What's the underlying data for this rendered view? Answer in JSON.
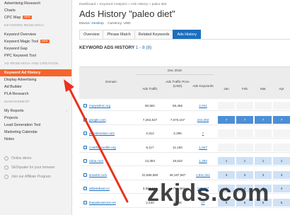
{
  "sidebar": {
    "items": [
      {
        "label": "Advertising Research",
        "type": "item"
      },
      {
        "label": "Charts",
        "type": "item"
      },
      {
        "label": "CPC Map",
        "type": "item",
        "badge": "NEW"
      },
      {
        "label": "KEYWORD RESEARCH",
        "type": "section"
      },
      {
        "label": "Keyword Overview",
        "type": "item"
      },
      {
        "label": "Keyword Magic Tool",
        "type": "item",
        "badge": "NEW"
      },
      {
        "label": "Keyword Gap",
        "type": "item"
      },
      {
        "label": "PPC Keyword Tool",
        "type": "item"
      },
      {
        "label": "AD RESEARCH AND CREATION",
        "type": "section"
      },
      {
        "label": "Keyword Ad History",
        "type": "active"
      },
      {
        "label": "Display Advertising",
        "type": "item"
      },
      {
        "label": "Ad Builder",
        "type": "item"
      },
      {
        "label": "PLA Research",
        "type": "item"
      },
      {
        "label": "MANAGEMENT",
        "type": "section"
      },
      {
        "label": "My Reports",
        "type": "item",
        "chevron": "›"
      },
      {
        "label": "Projects",
        "type": "item"
      },
      {
        "label": "Lead Generation Tool",
        "type": "item"
      },
      {
        "label": "Marketing Calendar",
        "type": "item"
      },
      {
        "label": "Notes",
        "type": "item"
      }
    ],
    "bottom": [
      {
        "label": "Online demo"
      },
      {
        "label": "SEOquake for your browser"
      },
      {
        "label": "Join our Affiliate Program"
      }
    ]
  },
  "main": {
    "breadcrumb": "Dashboard  »  Keyword Analytics  »  Ads History  »  paleo diet",
    "title": "Ads History \"paleo diet\"",
    "device_label": "Device:",
    "device_value": "Desktop",
    "currency_label": "Currency:",
    "currency_value": "USD",
    "tabs": [
      {
        "label": "Overview",
        "active": false
      },
      {
        "label": "Phrase Match",
        "active": false
      },
      {
        "label": "Related Keywords",
        "active": false
      },
      {
        "label": "Ads History",
        "active": true
      }
    ],
    "section_title": "KEYWORD ADS HISTORY",
    "section_count": "1 - 8 (8)"
  },
  "table": {
    "group_header": "Dec 2018",
    "headers": {
      "domain": "Domain",
      "ads_traffic": "Ads Traffic",
      "ads_traffic_price": "Ads Traffic Price (USD)",
      "ads_keywords": "Ads Keywords",
      "months": [
        "Jan",
        "Feb",
        "Mar",
        "Apr"
      ]
    },
    "rows": [
      {
        "domain": "marysdmic.org",
        "traffic": "90,581",
        "price": "59,486",
        "keywords": "2,041",
        "months": [
          "",
          "",
          "",
          ""
        ]
      },
      {
        "domain": "google.com",
        "traffic": "7,262,827",
        "price": "7,670,157",
        "keywords": "244,292",
        "months": [
          "7",
          "7",
          "7",
          "7"
        ]
      },
      {
        "domain": "paleoleonian.com",
        "traffic": "3,312",
        "price": "2,285",
        "keywords": "7",
        "months": [
          "",
          "",
          "",
          ""
        ]
      },
      {
        "domain": "cookforyourlife.org",
        "traffic": "8,117",
        "price": "11,160",
        "keywords": "1,027",
        "months": [
          "",
          "",
          "",
          ""
        ]
      },
      {
        "domain": "ndoa.com",
        "traffic": "13,383",
        "price": "19,632",
        "keywords": "1,293",
        "months": [
          "1",
          "1",
          "1",
          "1"
        ]
      },
      {
        "domain": "smarter.com",
        "traffic": "31,886,850",
        "price": "49,187,567",
        "keywords": "1,811,041",
        "months": [
          "3",
          "3",
          "3",
          "3"
        ]
      },
      {
        "domain": "athletebeat.co",
        "traffic": "3,084,184",
        "price": "2,796,384",
        "keywords": "149,427",
        "months": [
          "4",
          "4",
          "4",
          "4"
        ]
      },
      {
        "domain": "thepaleosecret.net",
        "traffic": "2,440",
        "price": "2,466",
        "keywords": "17",
        "months": [
          "5",
          "5",
          "5",
          "5"
        ]
      }
    ]
  },
  "watermark": "zkjds.com",
  "colors": {
    "accent": "#f4652d",
    "tab_active": "#1b6fbf",
    "month_dark": "#4c8fd6",
    "month_light": "#cfe1f5"
  }
}
